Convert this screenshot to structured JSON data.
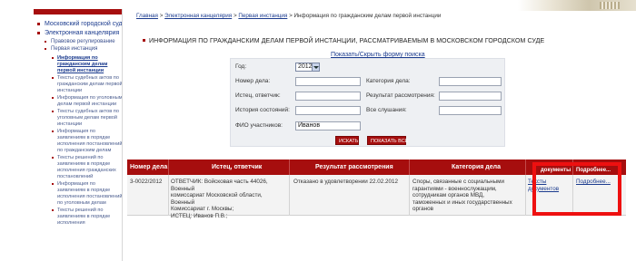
{
  "sidebar": {
    "items": [
      {
        "label": "Московский городской суд",
        "level": 0
      },
      {
        "label": "Электронная канцелярия",
        "level": 0
      },
      {
        "label": "Правовое регулирование",
        "level": 1
      },
      {
        "label": "Первая инстанция",
        "level": 1
      },
      {
        "label": "Информация по гражданским делам первой инстанции",
        "level": 2,
        "active": true
      },
      {
        "label": "Тексты судебных актов по гражданским делам первой инстанции",
        "level": 2
      },
      {
        "label": "Информация по уголовным делам первой инстанции",
        "level": 2
      },
      {
        "label": "Тексты судебных актов по уголовным делам первой инстанции",
        "level": 2
      },
      {
        "label": "Информация по заявлениям в порядке исполнения постановлений по гражданским делам",
        "level": 2
      },
      {
        "label": "Тексты решений по заявлениям в порядке исполнения гражданских постановлений",
        "level": 2
      },
      {
        "label": "Информация по заявлениям в порядке исполнения постановлений по уголовным делам",
        "level": 2
      },
      {
        "label": "Тексты решений по заявлениям в порядке исполнения",
        "level": 2
      }
    ]
  },
  "breadcrumb": {
    "home": "Главная",
    "sep": " > ",
    "office": "Электронная канцелярия",
    "first": "Первая инстанция",
    "current": "Информация по гражданским делам первой инстанции"
  },
  "page": {
    "title": "ИНФОРМАЦИЯ ПО ГРАЖДАНСКИМ ДЕЛАМ ПЕРВОЙ ИНСТАНЦИИ, РАССМАТРИВАЕМЫМ В МОСКОВСКОМ ГОРОДСКОМ СУДЕ",
    "toggle_form": "Показать/Скрыть форму поиска"
  },
  "form": {
    "year_label": "Год:",
    "year_value": "2012",
    "case_number_label": "Номер дела:",
    "case_category_label": "Категория дела:",
    "parties_label": "Истец, ответчик:",
    "result_label": "Результат рассмотрения:",
    "hearing_history_label": "История состояний:",
    "all_hearings_label": "Все слушания:",
    "participant_label": "ФИО участников:",
    "participant_value": "Иванов",
    "search_button": "ИСКАТЬ",
    "show_all_button": "ПОКАЗАТЬ ВСЕ"
  },
  "table": {
    "headers": {
      "case_number": "Номер дела",
      "parties": "Истец, ответчик",
      "result": "Результат рассмотрения",
      "category": "Категория дела",
      "documents": "документы",
      "details": "Подробнее..."
    },
    "rows": [
      {
        "case_number": "3-0022/2012",
        "parties_line1": "ОТВЕТЧИК: Войсковая часть 44026, Военный",
        "parties_line2": "комиссариат Московской области, Военный",
        "parties_line3": "Комиссариат г. Москвы;",
        "parties_line4": "ИСТЕЦ: Иванов П.В.;",
        "result": "Отказано в удовлетворении 22.02.2012",
        "category_line1": "Споры, связанные с социальными",
        "category_line2": "гарантиями - военнослужащим,",
        "category_line3": "сотрудникам органов МВД,",
        "category_line4": "таможенных и иных государственных",
        "category_line5": "органов",
        "documents_line1": "Тексты",
        "documents_line2": "документов",
        "details": "Подробнее..."
      }
    ]
  },
  "colors": {
    "accent": "#a60e0e",
    "link": "#1b3b8e",
    "highlight": "#ee1010"
  }
}
